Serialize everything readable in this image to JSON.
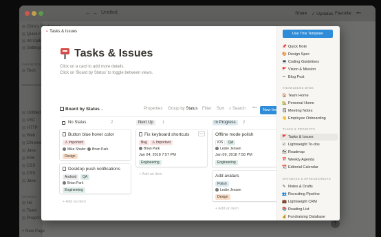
{
  "window": {
    "title": "Untitled",
    "nav_back": "←",
    "nav_forward": "→",
    "actions": {
      "share": "Share",
      "updates": "Updates",
      "favorite": "Favorite",
      "more": "•••"
    }
  },
  "sidebar": {
    "workspace": "Chris's Workspace",
    "items": [
      "Quick Find",
      "All Updates",
      "Settings"
    ],
    "favorites_label": "FAVORITES",
    "favorite_item": "Tech",
    "workspace_label": "WORKSPACE",
    "workspace_items": [
      "Untitled",
      "VSC",
      "HTTP",
      "Web",
      "Chrome",
      "Java",
      "ES6",
      "CSS",
      "CSS",
      "Java"
    ],
    "shared_label": "SHARED",
    "shared_items": [
      "Ho",
      "Team",
      "Projects"
    ],
    "new_page": "New Page",
    "help": "?"
  },
  "modal": {
    "breadcrumb": "Tasks & Issues",
    "title": "Tasks & Issues",
    "description": [
      "Click on a card to add more details.",
      "Click on 'Board by Status' to toggle between views."
    ],
    "viewbar": {
      "view": "Board by Status",
      "chevron": "⌄",
      "properties": "Properties",
      "group_by_label": "Group by",
      "group_by_value": "Status",
      "filter": "Filter",
      "sort": "Sort",
      "search": "Search",
      "more": "•••",
      "new_button": "New Item"
    },
    "columns": [
      {
        "name": "No Status",
        "count": "2",
        "color": "#ffffff",
        "add_label": "+ Add an item",
        "cards": [
          {
            "title": "Button blue hover color",
            "tags": [
              {
                "label": "Important",
                "color": "#fbe4e4",
                "icon": "⚠"
              }
            ],
            "people": [
              "Mike Shafer",
              "Brian Park"
            ],
            "bottom_tags": [
              {
                "label": "Design",
                "color": "#fadec9"
              }
            ],
            "date": ""
          },
          {
            "title": "Desktop push notifications",
            "tags": [
              {
                "label": "Android",
                "color": "#ebeced"
              },
              {
                "label": "QA",
                "color": "#ddedea"
              }
            ],
            "people": [
              "Brian Park"
            ],
            "bottom_tags": [
              {
                "label": "Engineering",
                "color": "#ddedea"
              }
            ],
            "date": ""
          }
        ]
      },
      {
        "name": "Next Up",
        "count": "1",
        "color": "#ebeced",
        "add_label": "+ Add an item",
        "cards": [
          {
            "title": "Fix keyboard shortcuts",
            "tags": [
              {
                "label": "Bug",
                "color": "#fbe4e4"
              },
              {
                "label": "Important",
                "color": "#fbe4e4",
                "icon": "⚠"
              }
            ],
            "people": [
              "Brian Park"
            ],
            "date": "Jan 04, 2018 7:57 PM",
            "bottom_tags": [
              {
                "label": "Engineering",
                "color": "#ddedea"
              }
            ]
          }
        ]
      },
      {
        "name": "In Progress",
        "count": "2",
        "color": "#ddebf1",
        "add_label": "+ Add an item",
        "cards": [
          {
            "title": "Offline mode polish",
            "tags": [
              {
                "label": "iOS",
                "color": "#ffffff"
              },
              {
                "label": "QA",
                "color": "#ddedea"
              }
            ],
            "people": [
              "Leslie Jensen"
            ],
            "date": "Jan 09, 2018 7:58 PM",
            "bottom_tags": [
              {
                "label": "Engineering",
                "color": "#ddedea"
              }
            ]
          },
          {
            "title": "Add avatars",
            "tags": [
              {
                "label": "Polish",
                "color": "#ddebf1"
              }
            ],
            "people": [
              "Leslie Jensen"
            ],
            "date": "",
            "bottom_tags": [
              {
                "label": "Design",
                "color": "#fadec9"
              }
            ]
          }
        ]
      }
    ]
  },
  "templates": {
    "use_button": "Use This Template",
    "personal": [
      {
        "label": "Quick Note",
        "icon": "📌"
      },
      {
        "label": "Design Spec",
        "icon": "🎨"
      },
      {
        "label": "Coding Guidelines",
        "icon": "💻"
      },
      {
        "label": "Vision & Mission",
        "icon": "🚩"
      },
      {
        "label": "Blog Post",
        "icon": "✏"
      }
    ],
    "kb_label": "KNOWLEDGE BASE",
    "knowledge": [
      {
        "label": "Team Home",
        "icon": "🏠"
      },
      {
        "label": "Personal Home",
        "icon": "🏡"
      },
      {
        "label": "Meeting Notes",
        "icon": "🗒"
      },
      {
        "label": "Employee Onboarding",
        "icon": "👋"
      }
    ],
    "tp_label": "TASKS & PROJECTS",
    "tasks": [
      {
        "label": "Tasks & Issues",
        "icon": "🚩",
        "active": true
      },
      {
        "label": "Lightweight To-dos",
        "icon": "☑"
      },
      {
        "label": "Roadmap",
        "icon": "🗺"
      },
      {
        "label": "Weekly Agenda",
        "icon": "📅"
      },
      {
        "label": "Editorial Calendar",
        "icon": "📆"
      }
    ],
    "db_label": "DATABASE & SPREADSHEETS",
    "databases": [
      {
        "label": "Notes & Drafts",
        "icon": "✎"
      },
      {
        "label": "Recruiting Pipeline",
        "icon": "👥"
      },
      {
        "label": "Lightweight CRM",
        "icon": "💼"
      },
      {
        "label": "Reading List",
        "icon": "📚"
      },
      {
        "label": "Fundraising Database",
        "icon": "💰"
      }
    ]
  },
  "colors": {
    "accent_blue": "#2e8cd8",
    "title_text": "#37352f",
    "muted_text": "#9b9a97",
    "issue_red": "#d44c47"
  }
}
